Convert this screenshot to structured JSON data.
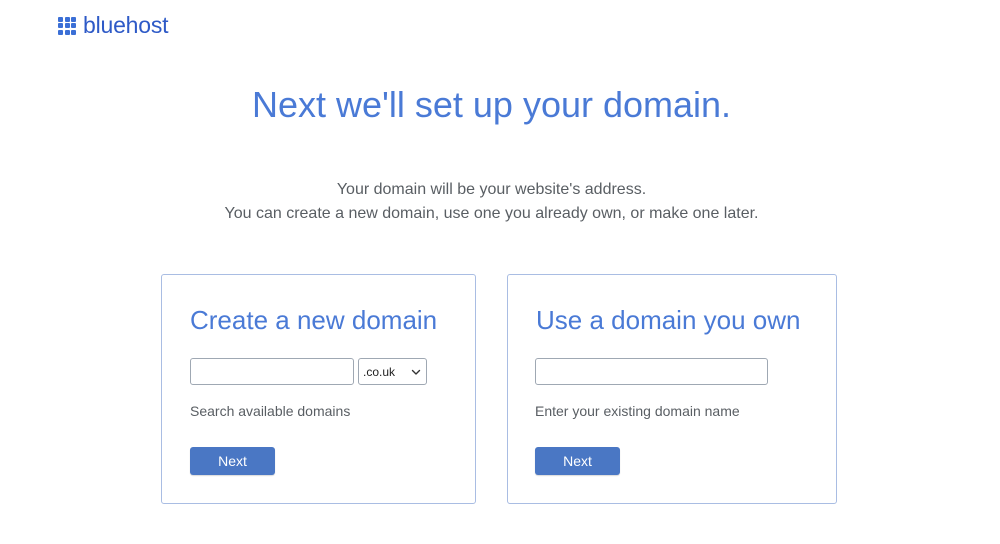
{
  "brand": {
    "name": "bluehost",
    "logo_icon": "grid-logo-icon",
    "color": "#2e5ac7"
  },
  "headline": "Next we'll set up your domain.",
  "subtitle": {
    "line1": "Your domain will be your website's address.",
    "line2": "You can create a new domain, use one you already own, or make one later."
  },
  "create_card": {
    "title": "Create a new domain",
    "input_value": "",
    "input_placeholder": "",
    "tld_selected": ".co.uk",
    "helper": "Search available domains",
    "button_label": "Next"
  },
  "own_card": {
    "title": "Use a domain you own",
    "input_value": "",
    "input_placeholder": "",
    "helper": "Enter your existing domain name",
    "button_label": "Next"
  },
  "colors": {
    "accent": "#4a7ad6",
    "button": "#4a77c4",
    "card_border": "#a9bde3"
  }
}
